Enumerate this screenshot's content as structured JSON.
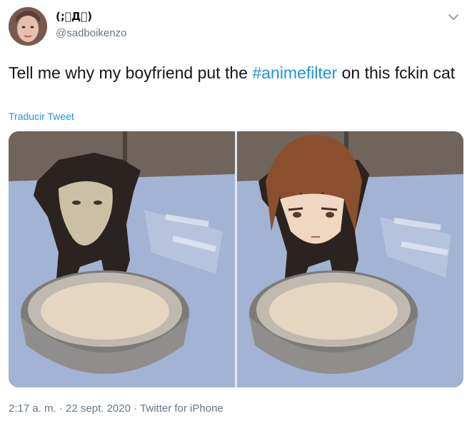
{
  "author": {
    "display_name": "(;゚Д゚)",
    "handle": "@sadboikenzo",
    "avatar_icon": "profile-photo"
  },
  "menu": {
    "icon": "chevron-down-icon"
  },
  "tweet": {
    "text_before": "Tell me why my boyfriend put the ",
    "hashtag": "#animefilter",
    "text_after": " on this fckin cat",
    "translate_label": "Traducir Tweet"
  },
  "media": {
    "panels": [
      {
        "name": "original-photo",
        "subject": "wet black kitten with cream on face standing in a metal bowl"
      },
      {
        "name": "anime-filter-photo",
        "subject": "same kitten with an anime-style face overlay"
      }
    ]
  },
  "meta": {
    "time": "2:17 a. m.",
    "sep1": " · ",
    "date": "22 sept. 2020",
    "sep2": " · ",
    "source": "Twitter for iPhone"
  },
  "colors": {
    "link": "#1b95e0",
    "secondary": "#657786",
    "text": "#14171a"
  }
}
